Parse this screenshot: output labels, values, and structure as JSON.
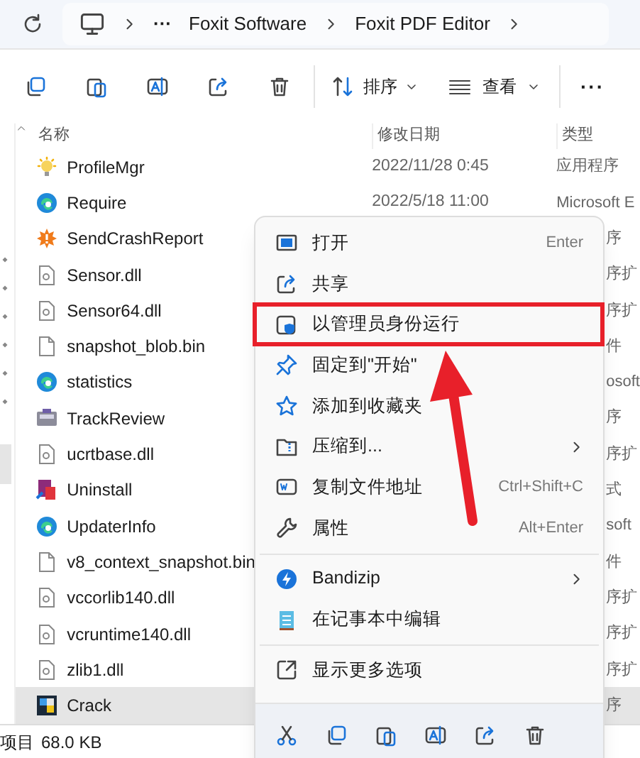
{
  "address_bar": {
    "ellipsis": "···",
    "crumbs": [
      "Foxit Software",
      "Foxit PDF Editor"
    ]
  },
  "toolbar": {
    "sort": "排序",
    "view": "查看",
    "more": "···"
  },
  "columns": [
    "名称",
    "修改日期",
    "类型"
  ],
  "files": [
    {
      "name": "ProfileMgr",
      "date": "2022/11/28 0:45",
      "type": "应用程序",
      "selected": false
    },
    {
      "name": "Require",
      "date": "2022/5/18 11:00",
      "type": "Microsoft E",
      "selected": false
    },
    {
      "name": "SendCrashReport",
      "type": "序",
      "selected": false
    },
    {
      "name": "Sensor.dll",
      "type": "序扩",
      "selected": false
    },
    {
      "name": "Sensor64.dll",
      "type": "序扩",
      "selected": false
    },
    {
      "name": "snapshot_blob.bin",
      "type": "件",
      "selected": false
    },
    {
      "name": "statistics",
      "type": "osoft",
      "selected": false
    },
    {
      "name": "TrackReview",
      "type": "序",
      "selected": false
    },
    {
      "name": "ucrtbase.dll",
      "type": "序扩",
      "selected": false
    },
    {
      "name": "Uninstall",
      "type": "式",
      "selected": false
    },
    {
      "name": "UpdaterInfo",
      "type": "soft",
      "selected": false
    },
    {
      "name": "v8_context_snapshot.bin",
      "type": "件",
      "selected": false
    },
    {
      "name": "vccorlib140.dll",
      "type": "序扩",
      "selected": false
    },
    {
      "name": "vcruntime140.dll",
      "type": "序扩",
      "selected": false
    },
    {
      "name": "zlib1.dll",
      "type": "序扩",
      "selected": false
    },
    {
      "name": "Crack",
      "type": "序",
      "selected": true
    }
  ],
  "status_bar": {
    "items": "项目",
    "size": "68.0 KB"
  },
  "context_menu": {
    "groups": [
      [
        {
          "label": "打开",
          "shortcut": "Enter",
          "highlighted": false
        },
        {
          "label": "共享",
          "highlighted": false
        },
        {
          "label": "以管理员身份运行",
          "highlighted": true
        },
        {
          "label": "固定到\"开始\"",
          "highlighted": false
        },
        {
          "label": "添加到收藏夹",
          "highlighted": false
        },
        {
          "label": "压缩到...",
          "submenu": true,
          "highlighted": false
        },
        {
          "label": "复制文件地址",
          "shortcut": "Ctrl+Shift+C",
          "highlighted": false
        },
        {
          "label": "属性",
          "shortcut": "Alt+Enter",
          "highlighted": false
        }
      ],
      [
        {
          "label": "Bandizip",
          "submenu": true,
          "highlighted": false
        },
        {
          "label": "在记事本中编辑",
          "highlighted": false
        }
      ],
      [
        {
          "label": "显示更多选项",
          "highlighted": false
        }
      ]
    ]
  }
}
